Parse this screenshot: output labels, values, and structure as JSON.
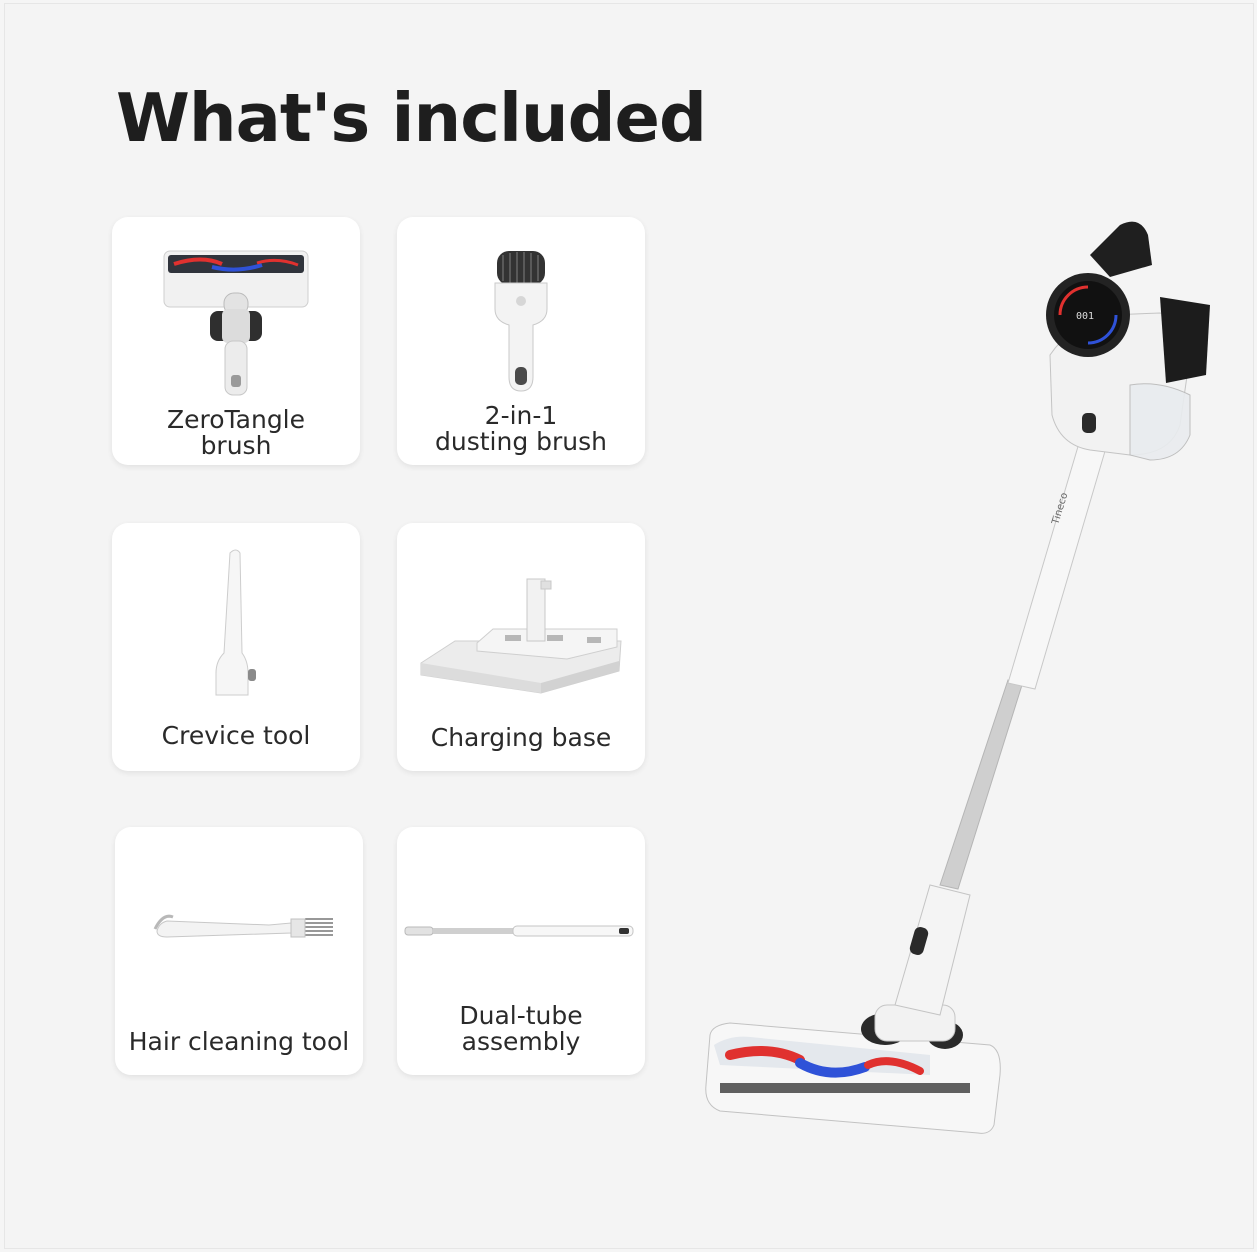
{
  "page": {
    "title": "What's included"
  },
  "items": [
    {
      "name": "zerotangle-brush",
      "label_lines": [
        "ZeroTangle",
        "brush"
      ],
      "icon": "floor-brush-head"
    },
    {
      "name": "dusting-brush",
      "label_lines": [
        "2-in-1",
        "dusting brush"
      ],
      "icon": "dusting-brush"
    },
    {
      "name": "crevice-tool",
      "label_lines": [
        "Crevice tool"
      ],
      "icon": "crevice-tool"
    },
    {
      "name": "charging-base",
      "label_lines": [
        "Charging base"
      ],
      "icon": "charging-dock"
    },
    {
      "name": "hair-cleaning-tool",
      "label_lines": [
        "Hair cleaning tool"
      ],
      "icon": "comb-tool"
    },
    {
      "name": "dual-tube",
      "label_lines": [
        "Dual-tube",
        "assembly"
      ],
      "icon": "extension-tube"
    }
  ],
  "logos": {
    "brand_mark": "Tineco"
  },
  "colors": {
    "background": "#f4f4f4",
    "card": "#ffffff",
    "title": "#1e1e1e",
    "accent_red": "#e0312f",
    "accent_blue": "#2f52d8"
  }
}
